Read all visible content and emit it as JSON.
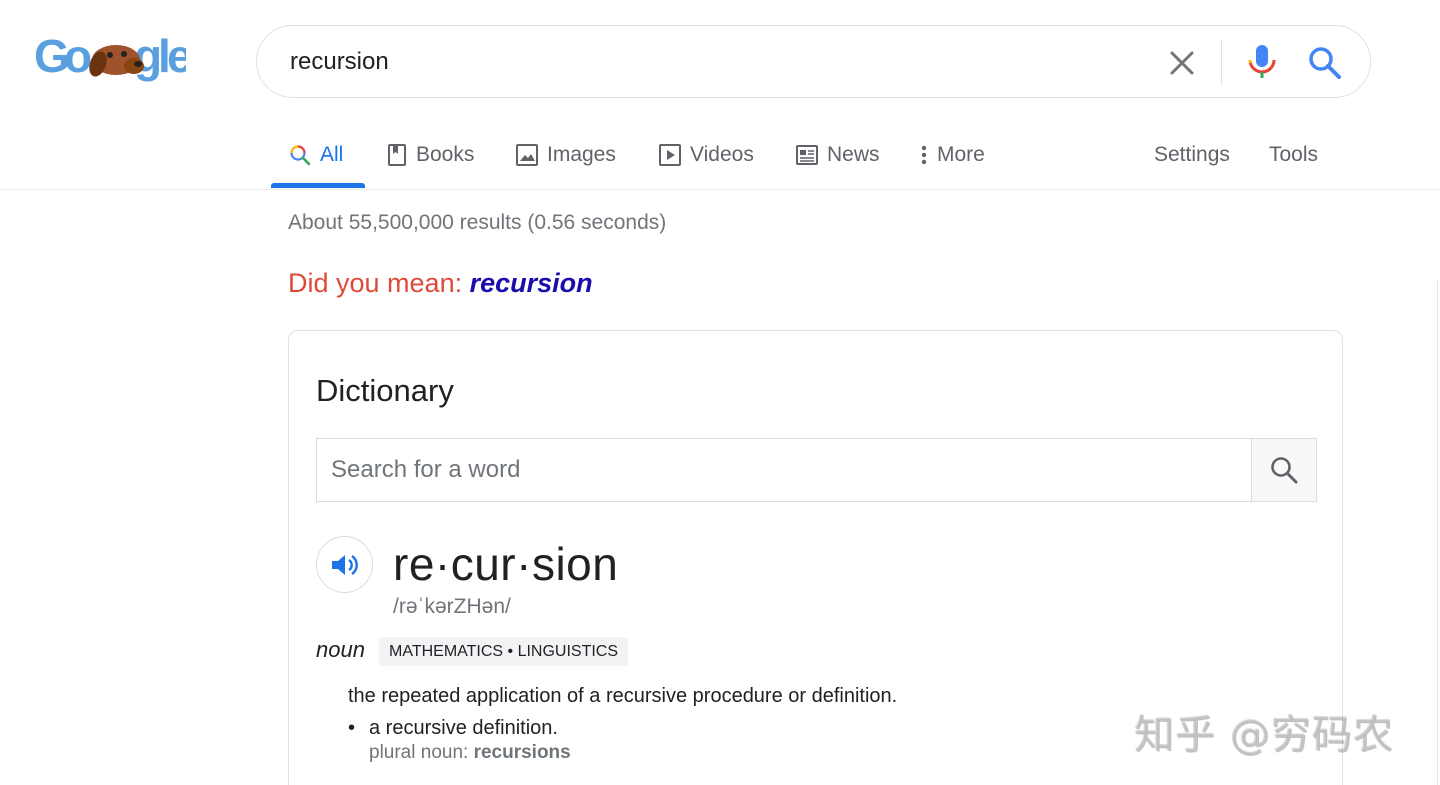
{
  "search": {
    "query": "recursion"
  },
  "tabs": [
    {
      "label": "All",
      "icon": "search-icon",
      "active": true
    },
    {
      "label": "Books",
      "icon": "book-icon"
    },
    {
      "label": "Images",
      "icon": "image-icon"
    },
    {
      "label": "Videos",
      "icon": "video-icon"
    },
    {
      "label": "News",
      "icon": "news-icon"
    },
    {
      "label": "More",
      "icon": "more-vert-icon"
    }
  ],
  "tools": {
    "settings": "Settings",
    "tools": "Tools"
  },
  "results": {
    "stats": "About 55,500,000 results (0.56 seconds)",
    "did_you_mean_prefix": "Did you mean:",
    "did_you_mean_term": "recursion"
  },
  "dictionary": {
    "title": "Dictionary",
    "search_placeholder": "Search for a word",
    "headword": "re·cur·sion",
    "phonetic": "/rəˈkərZHən/",
    "part_of_speech": "noun",
    "domain": "MATHEMATICS • LINGUISTICS",
    "definition": "the repeated application of a recursive procedure or definition.",
    "sub_definition": "a recursive definition.",
    "plural_label": "plural noun:",
    "plural_value": "recursions"
  },
  "watermark": "知乎 @穷码农",
  "colors": {
    "accent": "#1a73e8",
    "did_you_mean": "#dd4b39",
    "link": "#1a0dab"
  }
}
